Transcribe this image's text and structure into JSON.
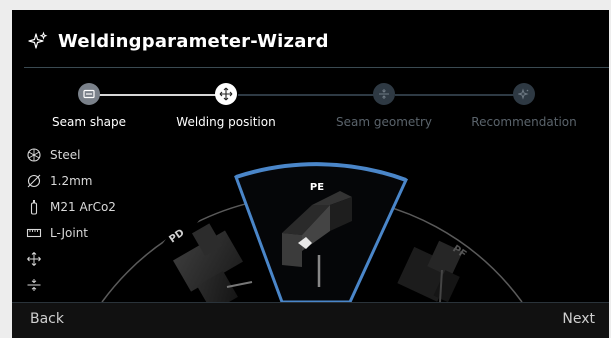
{
  "header": {
    "title": "Weldingparameter-Wizard",
    "icon": "sparkles-icon"
  },
  "stepper": {
    "steps": [
      {
        "label": "Seam shape",
        "state": "done",
        "icon": "seam-shape-icon"
      },
      {
        "label": "Welding position",
        "state": "active",
        "icon": "move-arrows-icon"
      },
      {
        "label": "Seam geometry",
        "state": "future",
        "icon": "seam-geometry-icon"
      },
      {
        "label": "Recommendation",
        "state": "future",
        "icon": "sparkles-icon"
      }
    ]
  },
  "params": [
    {
      "label": "Steel",
      "icon": "material-icon"
    },
    {
      "label": "1.2mm",
      "icon": "diameter-icon"
    },
    {
      "label": "M21 ArCo2",
      "icon": "gas-bottle-icon"
    },
    {
      "label": "L-Joint",
      "icon": "joint-icon"
    },
    {
      "label": "",
      "icon": "move-arrows-icon"
    },
    {
      "label": "",
      "icon": "seam-geometry-icon"
    }
  ],
  "positions": {
    "left": "PD",
    "center": "PE",
    "right": "PF",
    "selected": "PE"
  },
  "footer": {
    "back_label": "Back",
    "next_label": "Next"
  },
  "colors": {
    "accent": "#4a86c9",
    "panel_bg": "#000000",
    "outer_bg": "#ededed"
  }
}
